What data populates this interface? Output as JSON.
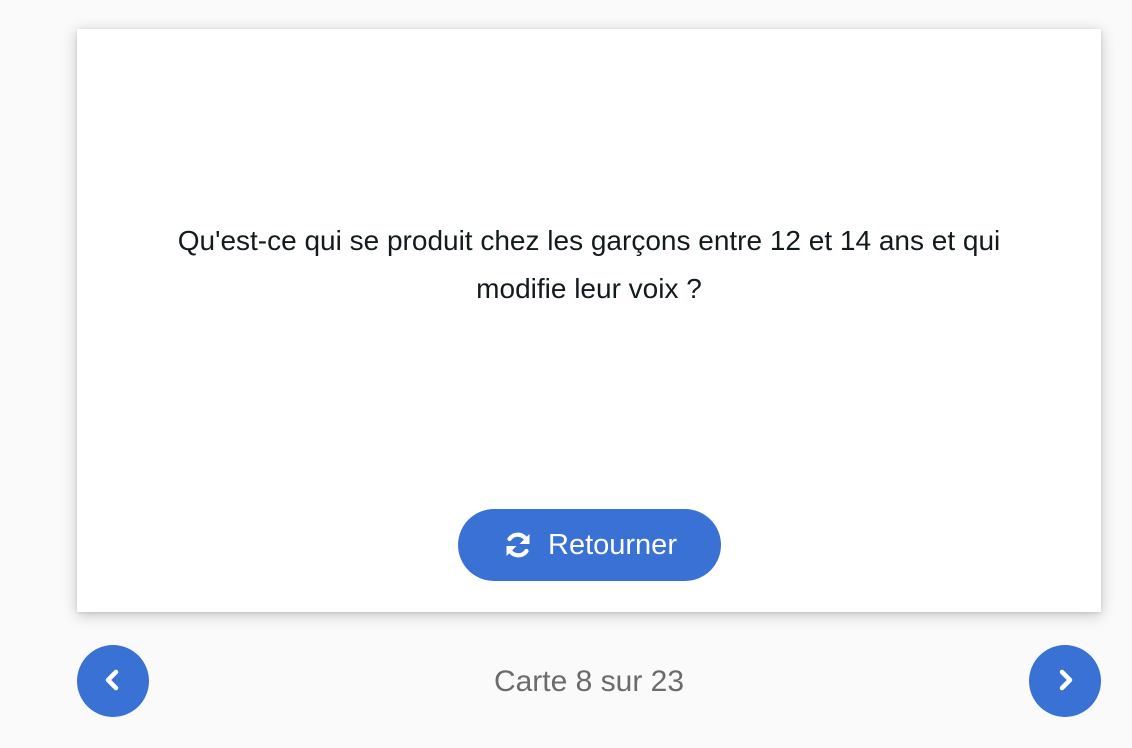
{
  "card": {
    "question": "Qu'est-ce qui se produit chez les garçons entre 12 et 14 ans et qui modifie leur voix ?",
    "flip_label": "Retourner",
    "flip_icon": "refresh-icon"
  },
  "navigation": {
    "prev_icon": "chevron-left-icon",
    "next_icon": "chevron-right-icon",
    "counter_text": "Carte 8 sur 23",
    "current": 8,
    "total": 23
  },
  "colors": {
    "accent": "#3a71d5",
    "text": "#111a1c",
    "muted_text": "#6b6b6b",
    "background": "#fafafa",
    "card": "#ffffff"
  }
}
